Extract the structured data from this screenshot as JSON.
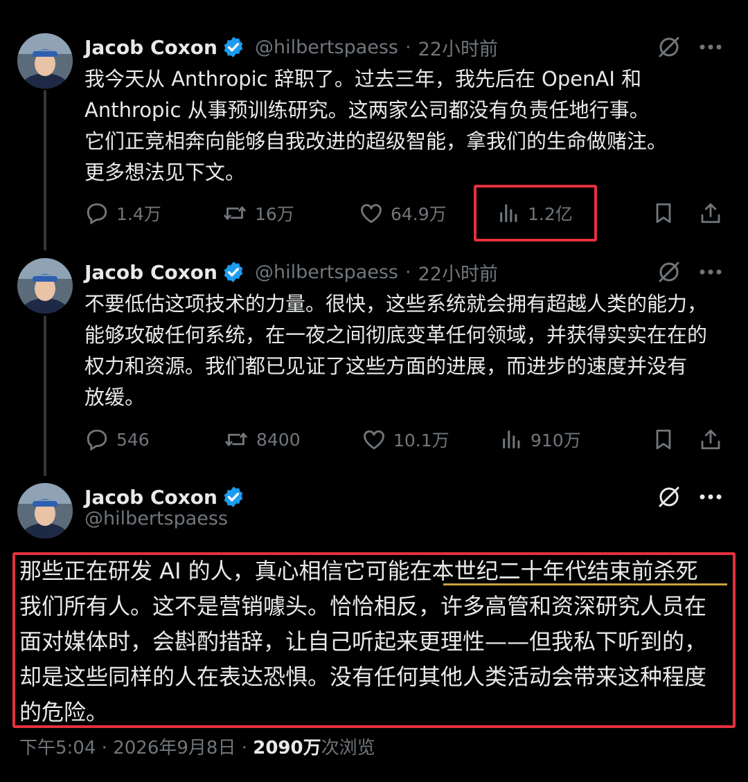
{
  "tweets": [
    {
      "name": "Jacob Coxon",
      "handle": "@hilbertspaess",
      "separator": "·",
      "time": "22小时前",
      "text": "我今天从 Anthropic 辞职了。过去三年，我先后在 OpenAI 和\nAnthropic 从事预训练研究。这两家公司都没有负责任地行事。\n它们正竞相奔向能够自我改进的超级智能，拿我们的生命做赌注。\n更多想法见下文。",
      "replies": "1.4万",
      "reposts": "16万",
      "likes": "64.9万",
      "views": "1.2亿"
    },
    {
      "name": "Jacob Coxon",
      "handle": "@hilbertspaess",
      "separator": "·",
      "time": "22小时前",
      "text": "不要低估这项技术的力量。很快，这些系统就会拥有超越人类的能力，\n能够攻破任何系统，在一夜之间彻底变革任何领域，并获得实实在在的\n权力和资源。我们都已见证了这些方面的进展，而进步的速度并没有\n放缓。",
      "replies": "546",
      "reposts": "8400",
      "likes": "10.1万",
      "views": "910万"
    },
    {
      "name": "Jacob Coxon",
      "handle": "@hilbertspaess",
      "text": "那些正在研发 AI 的人，真心相信它可能在本世纪二十年代结束前杀死\n我们所有人。这不是营销噱头。恰恰相反，许多高管和资深研究人员在\n面对媒体时，会斟酌措辞，让自己听起来更理性——但我私下听到的，\n却是这些同样的人在表达恐惧。没有任何其他人类活动会带来这种程度\n的危险。"
    }
  ],
  "footer": {
    "time": "下午5:04",
    "separator1": " · ",
    "date": "2026年9月8日",
    "separator2": " · ",
    "views_count": "2090万",
    "views_label": "次浏览"
  },
  "colors": {
    "background": "#000000",
    "text": "#e7e9ea",
    "muted": "#71767b",
    "verified": "#1d9bf0",
    "highlight_box": "#e5303f",
    "underline": "#c9a23a"
  }
}
